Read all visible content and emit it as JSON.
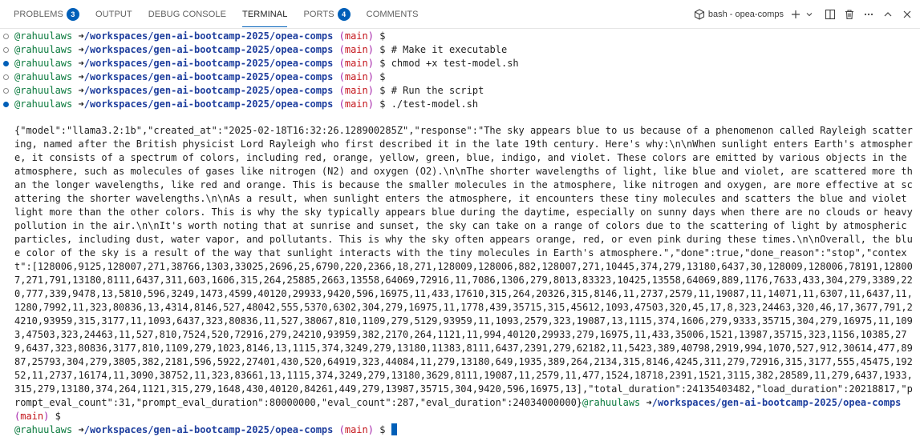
{
  "panel": {
    "tabs": [
      {
        "label": "PROBLEMS",
        "badge": "3"
      },
      {
        "label": "OUTPUT",
        "badge": null
      },
      {
        "label": "DEBUG CONSOLE",
        "badge": null
      },
      {
        "label": "TERMINAL",
        "badge": null,
        "active": true
      },
      {
        "label": "PORTS",
        "badge": "4"
      },
      {
        "label": "COMMENTS",
        "badge": null
      }
    ],
    "terminal_name": "bash - opea-comps",
    "accent_color": "#005fb8"
  },
  "prompt": {
    "user": "@rahuulaws",
    "arrow": "➜",
    "path": "/workspaces/gen-ai-bootcamp-2025/opea-comps",
    "branch_open": "(",
    "branch": "main",
    "branch_close": ")",
    "symbol": "$"
  },
  "commands": [
    {
      "text": "",
      "status": "empty"
    },
    {
      "text": "# Make it executable",
      "status": "empty"
    },
    {
      "text": "chmod +x test-model.sh",
      "status": "done"
    },
    {
      "text": "",
      "status": "empty"
    },
    {
      "text": "# Run the script",
      "status": "empty"
    },
    {
      "text": "./test-model.sh",
      "status": "done"
    }
  ],
  "output": "{\"model\":\"llama3.2:1b\",\"created_at\":\"2025-02-18T16:32:26.128900285Z\",\"response\":\"The sky appears blue to us because of a phenomenon called Rayleigh scattering, named after the British physicist Lord Rayleigh who first described it in the late 19th century. Here's why:\\n\\nWhen sunlight enters Earth's atmosphere, it consists of a spectrum of colors, including red, orange, yellow, green, blue, indigo, and violet. These colors are emitted by various objects in the atmosphere, such as molecules of gases like nitrogen (N2) and oxygen (O2).\\n\\nThe shorter wavelengths of light, like blue and violet, are scattered more than the longer wavelengths, like red and orange. This is because the smaller molecules in the atmosphere, like nitrogen and oxygen, are more effective at scattering the shorter wavelengths.\\n\\nAs a result, when sunlight enters the atmosphere, it encounters these tiny molecules and scatters the blue and violet light more than the other colors. This is why the sky typically appears blue during the daytime, especially on sunny days when there are no clouds or heavy pollution in the air.\\n\\nIt's worth noting that at sunrise and sunset, the sky can take on a range of colors due to the scattering of light by atmospheric particles, including dust, water vapor, and pollutants. This is why the sky often appears orange, red, or even pink during these times.\\n\\nOverall, the blue color of the sky is a result of the way that sunlight interacts with the tiny molecules in Earth's atmosphere.\",\"done\":true,\"done_reason\":\"stop\",\"context\":[128006,9125,128007,271,38766,1303,33025,2696,25,6790,220,2366,18,271,128009,128006,882,128007,271,10445,374,279,13180,6437,30,128009,128006,78191,128007,271,791,13180,8111,6437,311,603,1606,315,264,25885,2663,13558,64069,72916,11,7086,1306,279,8013,83323,10425,13558,64069,889,1176,7633,433,304,279,3389,220,777,339,9478,13,5810,596,3249,1473,4599,40120,29933,9420,596,16975,11,433,17610,315,264,20326,315,8146,11,2737,2579,11,19087,11,14071,11,6307,11,6437,11,1280,7992,11,323,80836,13,4314,8146,527,48042,555,5370,6302,304,279,16975,11,1778,439,35715,315,45612,1093,47503,320,45,17,8,323,24463,320,46,17,3677,791,24210,93959,315,3177,11,1093,6437,323,80836,11,527,38067,810,1109,279,5129,93959,11,1093,2579,323,19087,13,1115,374,1606,279,9333,35715,304,279,16975,11,1093,47503,323,24463,11,527,810,7524,520,72916,279,24210,93959,382,2170,264,1121,11,994,40120,29933,279,16975,11,433,35006,1521,13987,35715,323,1156,10385,279,6437,323,80836,3177,810,1109,279,1023,8146,13,1115,374,3249,279,13180,11383,8111,6437,2391,279,62182,11,5423,389,40798,2919,994,1070,527,912,30614,477,8987,25793,304,279,3805,382,2181,596,5922,27401,430,520,64919,323,44084,11,279,13180,649,1935,389,264,2134,315,8146,4245,311,279,72916,315,3177,555,45475,19252,11,2737,16174,11,3090,38752,11,323,83661,13,1115,374,3249,279,13180,3629,8111,19087,11,2579,11,477,1524,18718,2391,1521,3115,382,28589,11,279,6437,1933,315,279,13180,374,264,1121,315,279,1648,430,40120,84261,449,279,13987,35715,304,9420,596,16975,13],\"total_duration\":24135403482,\"load_duration\":20218817,\"prompt_eval_count\":31,\"prompt_eval_duration\":80000000,\"eval_count\":287,\"eval_duration\":24034000000}"
}
